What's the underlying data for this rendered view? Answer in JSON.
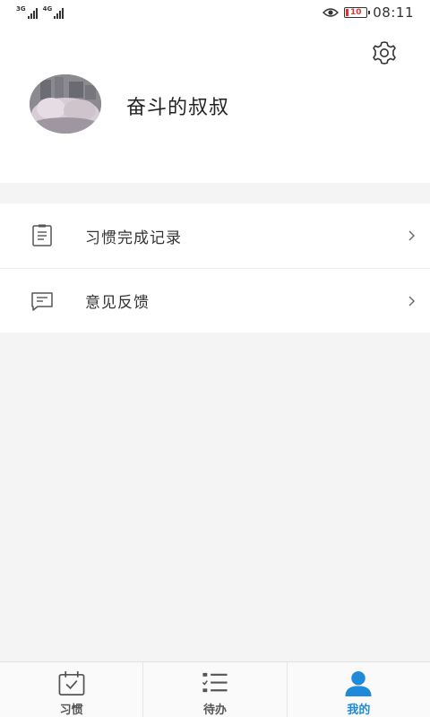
{
  "status_bar": {
    "network1": "3G",
    "network2": "4G",
    "battery": "10",
    "time": "08:11",
    "icons": [
      "signal-icon",
      "eye-icon",
      "battery-icon"
    ]
  },
  "profile": {
    "username": "奋斗的叔叔",
    "settings_icon": "gear-icon"
  },
  "menu": {
    "items": [
      {
        "label": "习惯完成记录",
        "icon": "clipboard-icon"
      },
      {
        "label": "意见反馈",
        "icon": "feedback-icon"
      }
    ]
  },
  "tabbar": {
    "tabs": [
      {
        "label": "习惯",
        "icon": "calendar-check-icon",
        "active": false
      },
      {
        "label": "待办",
        "icon": "todo-list-icon",
        "active": false
      },
      {
        "label": "我的",
        "icon": "user-icon",
        "active": true
      }
    ]
  },
  "colors": {
    "accent": "#1f8ad8",
    "background": "#f4f4f4",
    "battery_low": "#e0342c"
  }
}
